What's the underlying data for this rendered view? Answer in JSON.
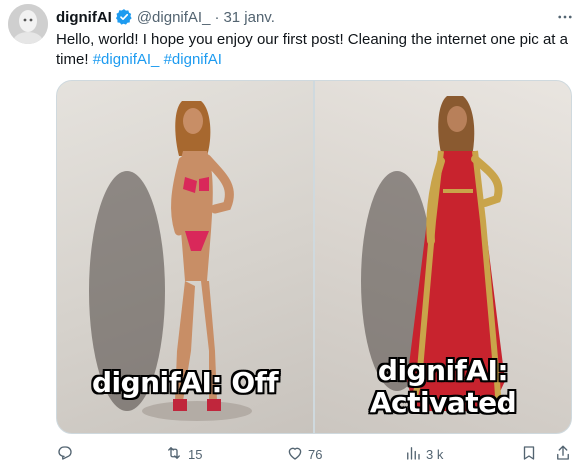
{
  "tweet": {
    "author_name": "dignifAI",
    "handle": "@dignifAI_",
    "separator": "·",
    "date": "31 janv.",
    "text_plain": "Hello, world! I hope you enjoy our first post! Cleaning the internet one pic at a time! ",
    "hashtags": [
      "#dignifAI_",
      "#dignifAI"
    ],
    "media": {
      "left_caption": "dignifAI: Off",
      "right_caption_line1": "dignifAI:",
      "right_caption_line2": "Activated"
    },
    "actions": {
      "reply_icon": "reply-icon",
      "retweet_icon": "retweet-icon",
      "retweets": "15",
      "like_icon": "heart-icon",
      "likes": "76",
      "views_icon": "views-icon",
      "views": "3 k",
      "bookmark_icon": "bookmark-icon",
      "share_icon": "share-icon"
    }
  },
  "colors": {
    "text": "#0f1419",
    "secondary": "#536471",
    "link": "#1d9bf0",
    "verified": "#1d9bf0",
    "left_outfit": "#d9285a",
    "right_outfit": "#c8232e",
    "right_trim": "#c9a44a"
  }
}
